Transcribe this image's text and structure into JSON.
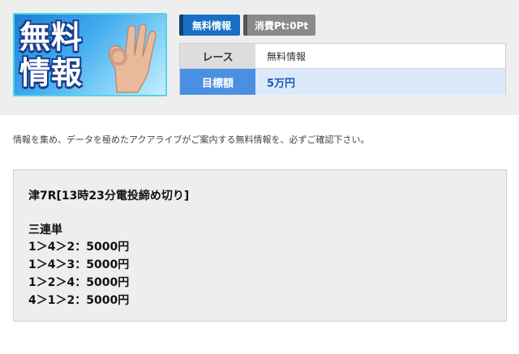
{
  "thumbnail": {
    "title_line1": "無料",
    "title_line2": "情報"
  },
  "badges": {
    "free_info": "無料情報",
    "points": "消費Pt:0Pt"
  },
  "info_table": {
    "race_label": "レース",
    "race_value": "無料情報",
    "target_label": "目標額",
    "target_value": "5万円"
  },
  "intro_text": "情報を集め、データを極めたアクアライブがご案内する無料情報を、必ずご確認下さい。",
  "content": {
    "race_line": "津7R[13時23分電投締め切り]",
    "bet_type": "三連単",
    "bets": [
      "1＞4＞2：5000円",
      "1＞4＞3：5000円",
      "1＞2＞4：5000円",
      "4＞1＞2：5000円"
    ]
  },
  "colors": {
    "header_bg": "#eeeeee",
    "badge_free": "#1a6fc4",
    "badge_points": "#8a8a8a",
    "target_label_bg": "#4a90e2",
    "target_value_bg": "#dbe9fb"
  }
}
